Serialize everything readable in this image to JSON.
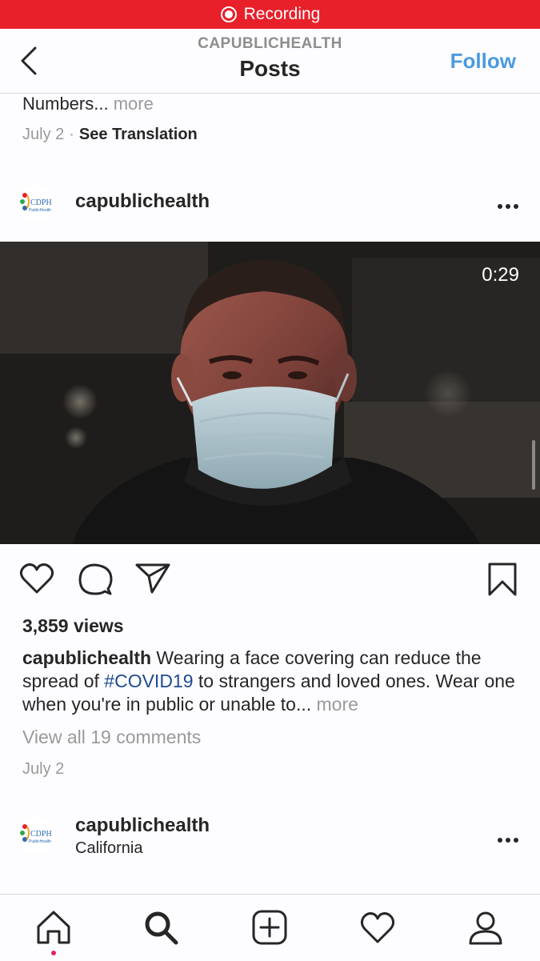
{
  "recording": {
    "label": "Recording",
    "color": "#e8202a"
  },
  "header": {
    "account": "CAPUBLICHEALTH",
    "title": "Posts",
    "follow_label": "Follow"
  },
  "previous_post": {
    "caption_tail": "Numbers...",
    "more_label": "more",
    "date": "July 2",
    "translation_label": "See Translation"
  },
  "post": {
    "username": "capublichealth",
    "avatar_text": "CDPH",
    "avatar_subtext": "PublicHealth",
    "video_duration": "0:29",
    "views": "3,859 views",
    "caption": {
      "username": "capublichealth",
      "text_before": " Wearing a face covering can reduce the spread of ",
      "hashtag": "#COVID19",
      "text_after": " to strangers and loved ones. Wear one when you're in public or unable to...",
      "more_label": "more"
    },
    "comments_label": "View all 19 comments",
    "date": "July 2"
  },
  "next_post": {
    "username": "capublichealth",
    "location": "California",
    "avatar_text": "CDPH",
    "avatar_subtext": "PublicHealth"
  },
  "tabbar": {
    "items": [
      "home-icon",
      "search-icon",
      "new-post-icon",
      "activity-heart-icon",
      "profile-icon"
    ],
    "notification_color": "#e0245e"
  },
  "colors": {
    "accent": "#4a9be0",
    "hashtag": "#1f4c90",
    "muted": "#9a9a9a"
  }
}
